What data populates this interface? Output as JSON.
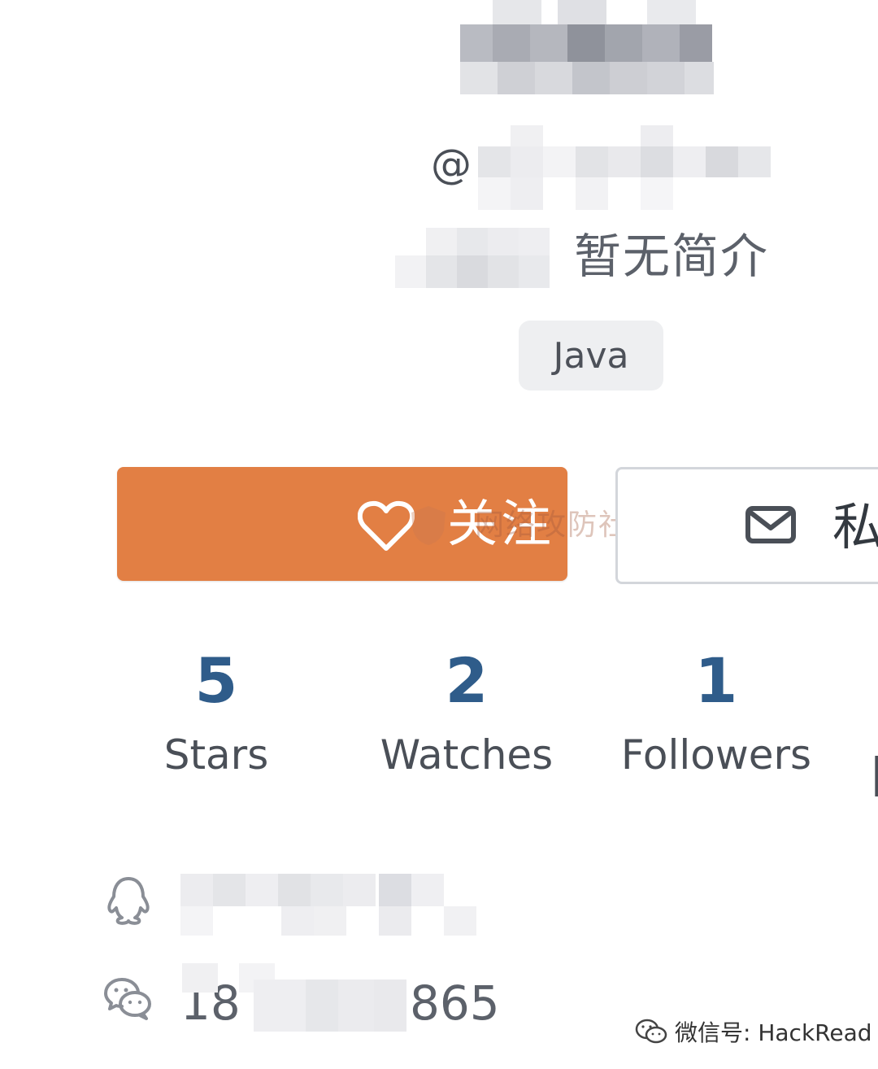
{
  "profile": {
    "handle_prefix": "@",
    "bio": "暂无简介",
    "tag": "Java"
  },
  "actions": {
    "follow_label": "关注",
    "follow_watermark": "网络攻防社区",
    "message_label": "私"
  },
  "stats": [
    {
      "value": "5",
      "label": "Stars"
    },
    {
      "value": "2",
      "label": "Watches"
    },
    {
      "value": "1",
      "label": "Followers"
    }
  ],
  "contacts": {
    "wechat_prefix": "18",
    "wechat_suffix": "865"
  },
  "footer": {
    "watermark": "微信号: HackRead"
  },
  "colors": {
    "accent_orange": "#e27f44",
    "stat_number_blue": "#2f5c8a",
    "tag_bg": "#eeeff1"
  },
  "icons": [
    "heart-icon",
    "mail-icon",
    "qq-icon",
    "wechat-icon"
  ]
}
